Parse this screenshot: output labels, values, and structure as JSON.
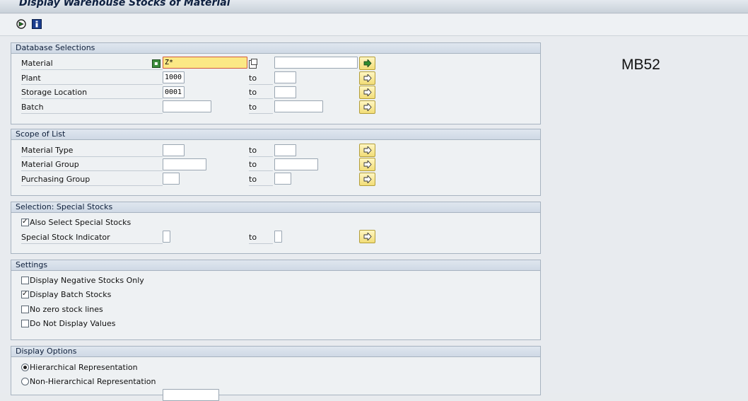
{
  "title": "Display Warehouse Stocks of Material",
  "transaction_code": "MB52",
  "toolbar": {
    "execute_icon": "execute-icon",
    "info_icon": "info-icon"
  },
  "to_label": "to",
  "database_selections": {
    "header": "Database Selections",
    "material": {
      "label": "Material",
      "low": "Z*",
      "high": ""
    },
    "plant": {
      "label": "Plant",
      "low": "1000",
      "high": ""
    },
    "storage_location": {
      "label": "Storage Location",
      "low": "0001",
      "high": ""
    },
    "batch": {
      "label": "Batch",
      "low": "",
      "high": ""
    }
  },
  "scope_of_list": {
    "header": "Scope of List",
    "material_type": {
      "label": "Material Type",
      "low": "",
      "high": ""
    },
    "material_group": {
      "label": "Material Group",
      "low": "",
      "high": ""
    },
    "purchasing_group": {
      "label": "Purchasing Group",
      "low": "",
      "high": ""
    }
  },
  "special_stocks": {
    "header": "Selection: Special Stocks",
    "also_select": {
      "label": "Also Select Special Stocks",
      "checked": true
    },
    "indicator": {
      "label": "Special Stock Indicator",
      "low": "",
      "high": ""
    }
  },
  "settings": {
    "header": "Settings",
    "negative_only": {
      "label": "Display Negative Stocks Only",
      "checked": false
    },
    "batch_stocks": {
      "label": "Display Batch Stocks",
      "checked": true
    },
    "no_zero": {
      "label": "No zero stock lines",
      "checked": false
    },
    "no_values": {
      "label": "Do Not Display Values",
      "checked": false
    }
  },
  "display_options": {
    "header": "Display Options",
    "hierarchical": {
      "label": "Hierarchical Representation",
      "selected": true
    },
    "non_hierarchical": {
      "label": "Non-Hierarchical Representation",
      "selected": false
    }
  }
}
